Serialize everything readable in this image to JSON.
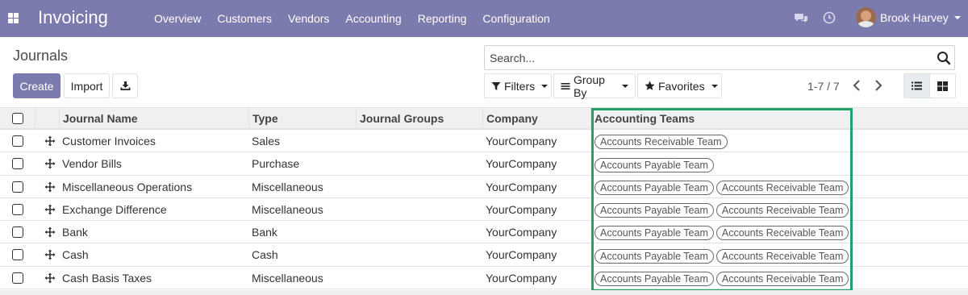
{
  "navbar": {
    "app_title": "Invoicing",
    "menu": [
      "Overview",
      "Customers",
      "Vendors",
      "Accounting",
      "Reporting",
      "Configuration"
    ],
    "user_name": "Brook Harvey",
    "color": "#7c7bad"
  },
  "control_panel": {
    "breadcrumb": "Journals",
    "create_label": "Create",
    "import_label": "Import",
    "search_placeholder": "Search...",
    "filters_label": "Filters",
    "group_by_label": "Group By",
    "favorites_label": "Favorites",
    "pager_value": "1-7 / 7"
  },
  "table": {
    "headers": [
      "Journal Name",
      "Type",
      "Journal Groups",
      "Company",
      "Accounting Teams"
    ],
    "rows": [
      {
        "name": "Customer Invoices",
        "type": "Sales",
        "groups": "",
        "company": "YourCompany",
        "teams": [
          "Accounts Receivable Team"
        ]
      },
      {
        "name": "Vendor Bills",
        "type": "Purchase",
        "groups": "",
        "company": "YourCompany",
        "teams": [
          "Accounts Payable Team"
        ]
      },
      {
        "name": "Miscellaneous Operations",
        "type": "Miscellaneous",
        "groups": "",
        "company": "YourCompany",
        "teams": [
          "Accounts Payable Team",
          "Accounts Receivable Team"
        ]
      },
      {
        "name": "Exchange Difference",
        "type": "Miscellaneous",
        "groups": "",
        "company": "YourCompany",
        "teams": [
          "Accounts Payable Team",
          "Accounts Receivable Team"
        ]
      },
      {
        "name": "Bank",
        "type": "Bank",
        "groups": "",
        "company": "YourCompany",
        "teams": [
          "Accounts Payable Team",
          "Accounts Receivable Team"
        ]
      },
      {
        "name": "Cash",
        "type": "Cash",
        "groups": "",
        "company": "YourCompany",
        "teams": [
          "Accounts Payable Team",
          "Accounts Receivable Team"
        ]
      },
      {
        "name": "Cash Basis Taxes",
        "type": "Miscellaneous",
        "groups": "",
        "company": "YourCompany",
        "teams": [
          "Accounts Payable Team",
          "Accounts Receivable Team"
        ]
      }
    ]
  },
  "highlight_color": "#22a067"
}
